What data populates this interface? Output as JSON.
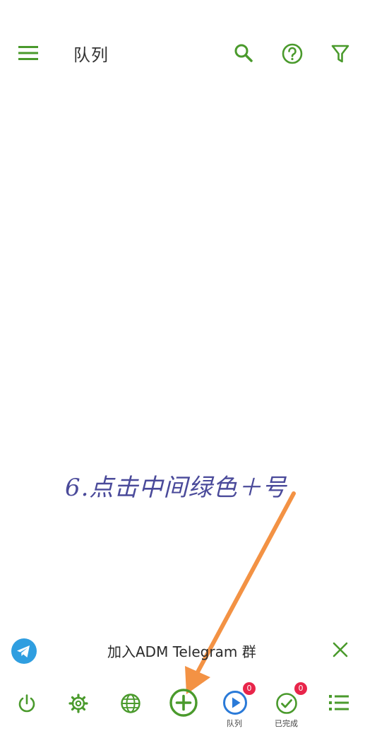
{
  "header": {
    "title": "队列"
  },
  "annotation": {
    "text": "6.点击中间绿色＋号"
  },
  "telegram_banner": {
    "text": "加入ADM Telegram 群"
  },
  "bottom_nav": {
    "queue_label": "队列",
    "completed_label": "已完成",
    "queue_badge": "0",
    "completed_badge": "0"
  },
  "colors": {
    "accent": "#4a9a2c",
    "telegram": "#2f9ee0",
    "queue_blue": "#2a7ad8",
    "badge": "#e8254a",
    "arrow": "#f39244"
  },
  "icons": [
    "menu-icon",
    "search-icon",
    "help-icon",
    "filter-icon",
    "telegram-icon",
    "close-icon",
    "power-icon",
    "gear-icon",
    "globe-icon",
    "add-icon",
    "play-icon",
    "check-icon",
    "list-icon"
  ]
}
